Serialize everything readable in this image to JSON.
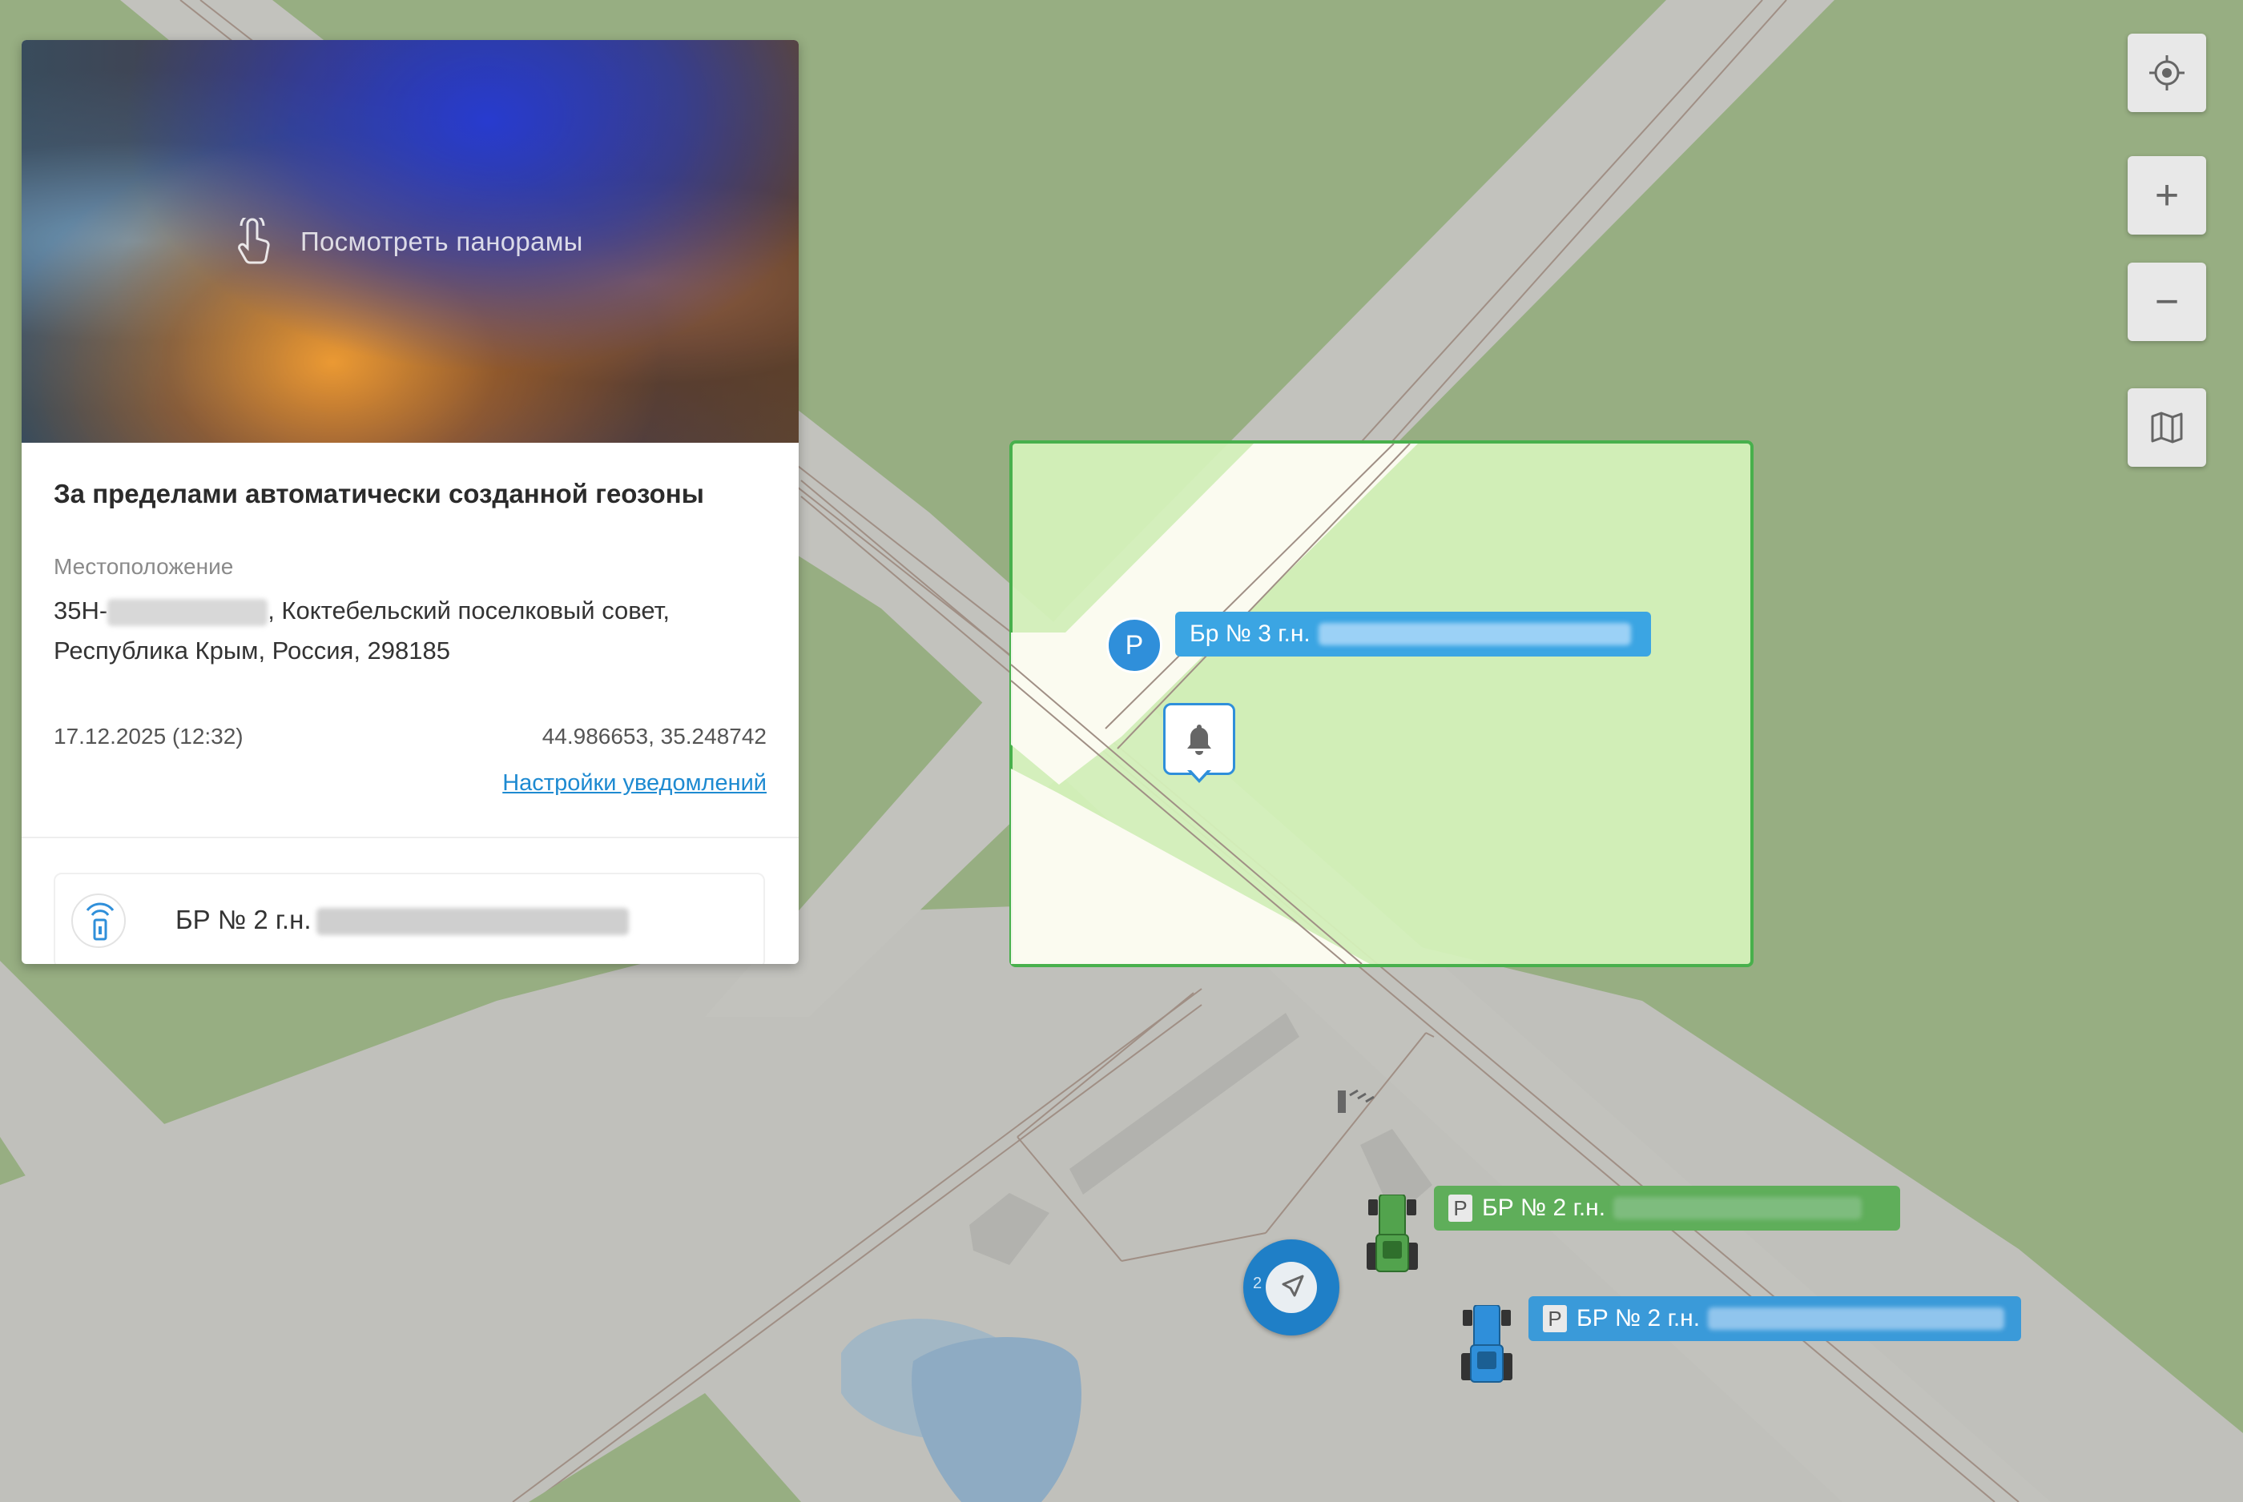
{
  "card": {
    "panorama_label": "Посмотреть панорамы",
    "title": "За пределами автоматически созданной геозоны",
    "location_label": "Местоположение",
    "address_prefix": "35Н-",
    "address_rest": ", Коктебельский поселковый совет,",
    "address_line2": "Республика Крым, Россия, 298185",
    "datetime": "17.12.2025 (12:32)",
    "coordinates": "44.986653, 35.248742",
    "notification_settings_link": "Настройки уведомлений",
    "device_name": "БР № 2 г.н."
  },
  "controls": {
    "locate_icon": "crosshair-icon",
    "zoom_in": "+",
    "zoom_out": "−",
    "layers_icon": "map-icon"
  },
  "map_labels": {
    "parking_marker": "P",
    "br3_label": "Бр № 3 г.н.",
    "green_vehicle_badge": "P",
    "green_vehicle_label": "БР № 2 г.н.",
    "blue_vehicle_badge": "P",
    "blue_vehicle_label": "БР № 2 г.н.",
    "cluster_count": "2"
  },
  "colors": {
    "map_background": "#97ae82",
    "road": "#c2c2bd",
    "geofence_fill": "#d6f3bc",
    "geofence_border": "#48b04c",
    "accent_blue": "#2f8fda",
    "vehicle_green": "#5fae5a",
    "link": "#1e8ad1"
  }
}
